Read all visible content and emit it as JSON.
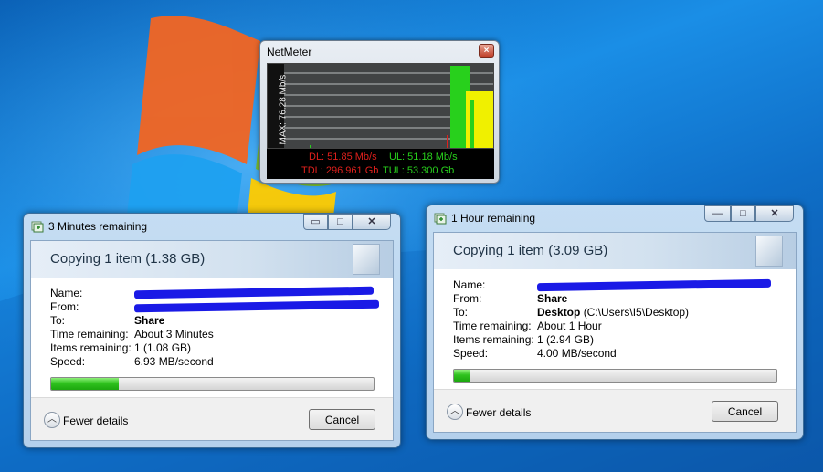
{
  "netmeter": {
    "title": "NetMeter",
    "close_glyph": "×",
    "max_label": "MAX: 76.28 Mb/s",
    "dl": "DL: 51.85 Mb/s",
    "ul": "UL: 51.18 Mb/s",
    "tdl": "TDL: 296.961 Gb",
    "tul": "TUL: 53.300 Gb",
    "colors": {
      "download": "#e0201c",
      "upload": "#28d01c",
      "overlap": "#f0f000"
    }
  },
  "dialog_left": {
    "title": "3 Minutes remaining",
    "heading": "Copying 1 item (1.38 GB)",
    "labels": {
      "name": "Name:",
      "from": "From:",
      "to": "To:",
      "time_remaining": "Time remaining:",
      "items_remaining": "Items remaining:",
      "speed": "Speed:"
    },
    "to_value": "Share",
    "time_remaining": "About 3 Minutes",
    "items_remaining": "1 (1.08 GB)",
    "speed": "6.93 MB/second",
    "progress_percent": 21,
    "fewer_details": "Fewer details",
    "cancel": "Cancel",
    "minimize_glyph": "▭",
    "maximize_glyph": "□",
    "close_glyph": "✕"
  },
  "dialog_right": {
    "title": "1 Hour remaining",
    "heading": "Copying 1 item (3.09 GB)",
    "labels": {
      "name": "Name:",
      "from": "From:",
      "to": "To:",
      "time_remaining": "Time remaining:",
      "items_remaining": "Items remaining:",
      "speed": "Speed:"
    },
    "from_value": "Share",
    "to_value_bold": "Desktop",
    "to_value_path": "(C:\\Users\\I5\\Desktop)",
    "time_remaining": "About 1 Hour",
    "items_remaining": "1 (2.94 GB)",
    "speed": "4.00 MB/second",
    "progress_percent": 5,
    "fewer_details": "Fewer details",
    "cancel": "Cancel",
    "minimize_glyph": "—",
    "maximize_glyph": "□",
    "close_glyph": "✕"
  }
}
